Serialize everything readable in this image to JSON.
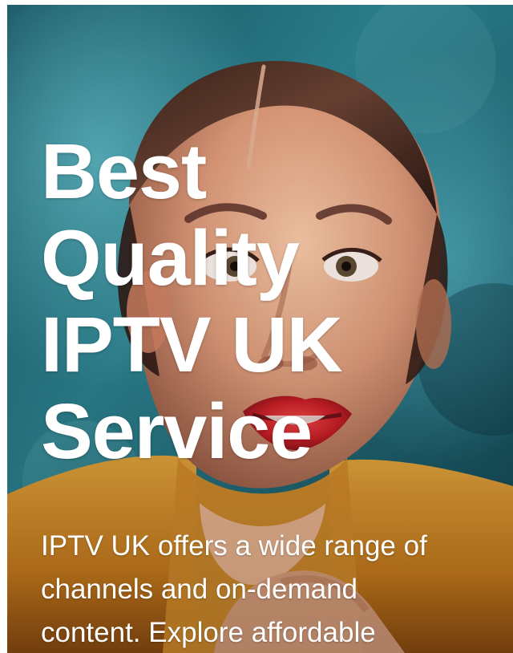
{
  "hero": {
    "image_icon": "woman-portrait-image",
    "headline_lines": [
      "Best",
      "Quality",
      "IPTV UK",
      "Service"
    ],
    "description_lines": [
      "IPTV UK offers a wide range of",
      "channels and on-demand",
      "content. Explore affordable"
    ]
  },
  "colors": {
    "background_teal": "#1f5f6e",
    "sweater_orange": "#d98a24",
    "lip_red": "#c81f26",
    "text_white": "#ffffff"
  }
}
